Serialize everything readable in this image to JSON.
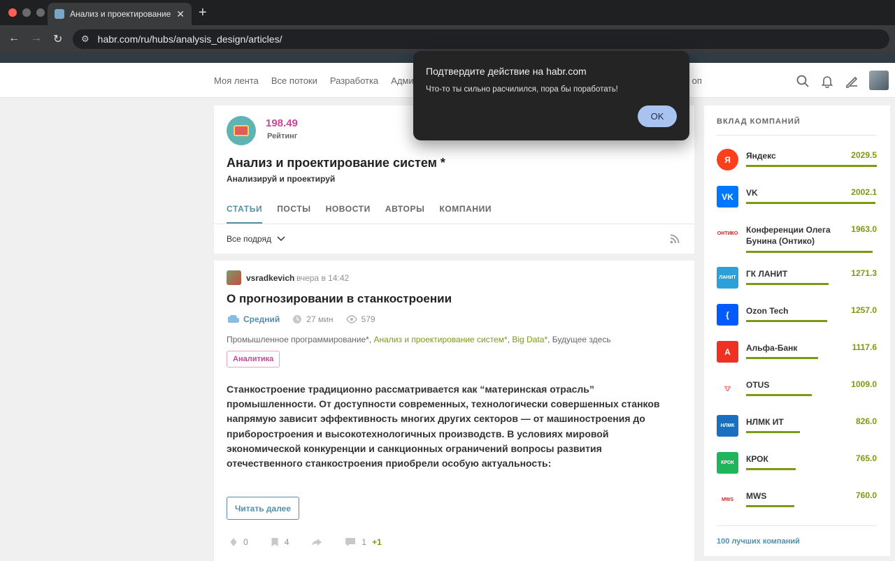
{
  "browser": {
    "tab_title": "Анализ и проектирование с",
    "url": "habr.com/ru/hubs/analysis_design/articles/"
  },
  "header": {
    "nav": [
      "Моя лента",
      "Все потоки",
      "Разработка",
      "Адми",
      "оп"
    ]
  },
  "hub": {
    "rating_value": "198.49",
    "rating_label": "Рейтинг",
    "title": "Анализ и проектирование систем *",
    "subtitle": "Анализируй и проектируй",
    "tabs": [
      "СТАТЬИ",
      "ПОСТЫ",
      "НОВОСТИ",
      "АВТОРЫ",
      "КОМПАНИИ"
    ],
    "filter_label": "Все подряд"
  },
  "article": {
    "author": "vsradkevich",
    "time": "вчера в 14:42",
    "title": "О прогнозировании в станкостроении",
    "level": "Средний",
    "read_time": "27 мин",
    "views": "579",
    "hubs": [
      {
        "text": "Промышленное программирование*",
        "sep": ", "
      },
      {
        "text": "Анализ и проектирование систем*",
        "sep": ", "
      },
      {
        "text": "Big Data*",
        "sep": ", "
      },
      {
        "text": "Будущее здесь",
        "sep": ""
      }
    ],
    "badge": "Аналитика",
    "excerpt": "Станкостроение традиционно рассматривается как “материнская отрасль” промышленности. От доступности современных, технологически совершенных станков напрямую зависит эффективность многих других секторов — от машиностроения до приборостроения и высокотехнологичных производств. В условиях мировой экономической конкуренции и санкционных ограничений вопросы развития отечественного станкостроения приобрели особую актуальность:",
    "read_more": "Читать далее",
    "votes": "0",
    "bookmarks": "4",
    "comments": "1",
    "comments_new": "+1"
  },
  "sidebar": {
    "heading": "ВКЛАД КОМПАНИЙ",
    "companies": [
      {
        "name": "Яндекс",
        "value": "2029.5",
        "fraction": 1.0,
        "logo_text": "Я",
        "logo_color": "#fc3f1d"
      },
      {
        "name": "VK",
        "value": "2002.1",
        "fraction": 0.99,
        "logo_text": "VK",
        "logo_color": "#0077ff"
      },
      {
        "name": "Конференции Олега Бунина (Онтико)",
        "value": "1963.0",
        "fraction": 0.97,
        "logo_text": "ОНТИКО",
        "logo_color": "#ffffff"
      },
      {
        "name": "ГК ЛАНИТ",
        "value": "1271.3",
        "fraction": 0.63,
        "logo_text": "ЛАНИТ",
        "logo_color": "#2ba0d9"
      },
      {
        "name": "Ozon Tech",
        "value": "1257.0",
        "fraction": 0.62,
        "logo_text": "{",
        "logo_color": "#005bff"
      },
      {
        "name": "Альфа-Банк",
        "value": "1117.6",
        "fraction": 0.55,
        "logo_text": "А",
        "logo_color": "#ef3124"
      },
      {
        "name": "OTUS",
        "value": "1009.0",
        "fraction": 0.5,
        "logo_text": "🐮",
        "logo_color": "#ffffff"
      },
      {
        "name": "НЛМК ИТ",
        "value": "826.0",
        "fraction": 0.41,
        "logo_text": "НЛМК",
        "logo_color": "#1a6fbf"
      },
      {
        "name": "КРОК",
        "value": "765.0",
        "fraction": 0.38,
        "logo_text": "КРОК",
        "logo_color": "#1fb55a"
      },
      {
        "name": "MWS",
        "value": "760.0",
        "fraction": 0.37,
        "logo_text": "MWS",
        "logo_color": "#ffffff"
      }
    ],
    "more_link": "100 лучших компаний"
  },
  "dialog": {
    "title": "Подтвердите действие на habr.com",
    "message": "Что-то ты сильно расчилился, пора бы поработать!",
    "ok_label": "OK"
  },
  "colors": {
    "accent": "#548eaa",
    "rating": "#c9479a",
    "positive": "#7b9a10"
  }
}
